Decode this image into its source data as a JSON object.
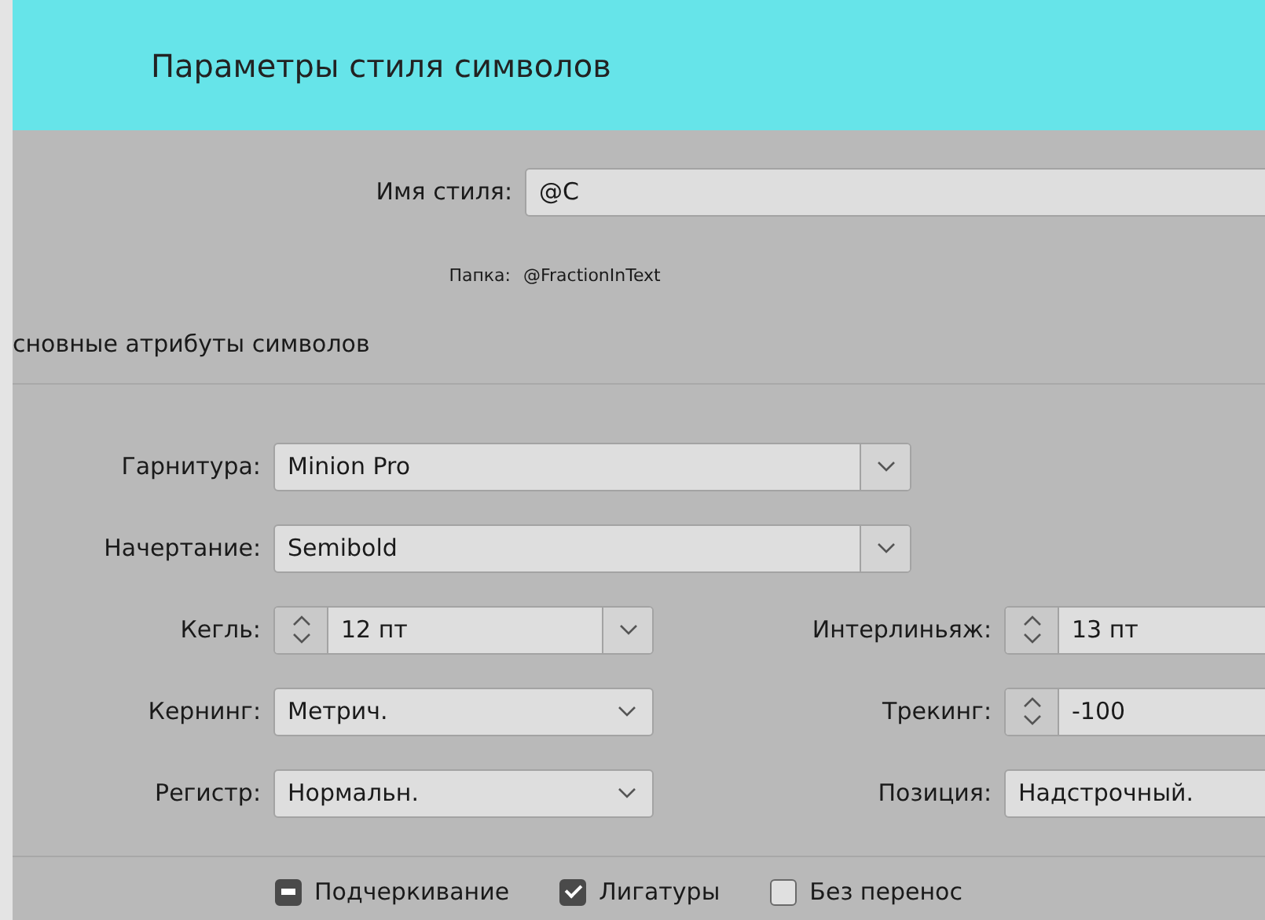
{
  "window": {
    "title": "Параметры стиля символов"
  },
  "style_name": {
    "label": "Имя стиля:",
    "value": "@C"
  },
  "folder": {
    "label": "Папка:",
    "value": "@FractionInText"
  },
  "section_title": "сновные атрибуты символов",
  "rows": [
    {
      "fields": [
        {
          "kind": "combo",
          "label": "Гарнитура:",
          "value": "Minion Pro"
        }
      ]
    },
    {
      "fields": [
        {
          "kind": "combo",
          "label": "Начертание:",
          "value": "Semibold"
        }
      ]
    },
    {
      "fields": [
        {
          "kind": "spin-combo",
          "label": "Кегль:",
          "value": "12 пт"
        },
        {
          "kind": "spin-combo",
          "label": "Интерлиньяж:",
          "value": "13 пт"
        }
      ]
    },
    {
      "fields": [
        {
          "kind": "select",
          "label": "Кернинг:",
          "value": "Метрич."
        },
        {
          "kind": "spin",
          "label": "Трекинг:",
          "value": "-100"
        }
      ]
    },
    {
      "fields": [
        {
          "kind": "select",
          "label": "Регистр:",
          "value": "Нормальн."
        },
        {
          "kind": "select",
          "label": "Позиция:",
          "value": "Надстрочный."
        }
      ]
    }
  ],
  "checkboxes": [
    {
      "label": "Подчеркивание",
      "checked": false,
      "mixed": true
    },
    {
      "label": "Лигатуры",
      "checked": true,
      "mixed": false
    },
    {
      "label": "Без перенос",
      "checked": false,
      "mixed": false
    }
  ]
}
